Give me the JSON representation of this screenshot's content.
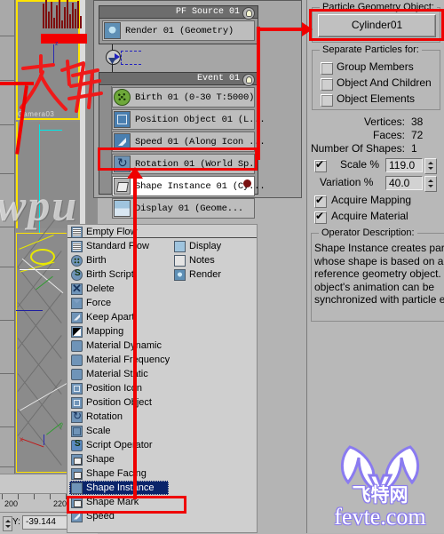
{
  "viewport": {
    "camera_label": "Camera03",
    "ruler_ticks": [
      "200",
      "220"
    ],
    "coord_axis_label": "Y:",
    "coord_value": "-39.144",
    "axis_z_label": "z",
    "axis_x_label": "x",
    "axis_y_label": "y"
  },
  "watermark": {
    "text": "wpu"
  },
  "particle_view": {
    "source": {
      "title": "PF Source 01",
      "rows": [
        {
          "label": "Render 01  (Geometry)",
          "icon": "render-icon"
        }
      ]
    },
    "event": {
      "title": "Event 01",
      "rows": [
        {
          "label": "Birth 01  (0-30 T:5000)",
          "icon": "birth-icon"
        },
        {
          "label": "Position Object 01  (L...",
          "icon": "position-object-icon"
        },
        {
          "label": "Speed 01 (Along Icon ...",
          "icon": "speed-icon"
        },
        {
          "label": "Rotation 01  (World Sp..",
          "icon": "rotation-icon"
        },
        {
          "label": "Shape Instance 01  (Cy...",
          "icon": "shape-instance-icon"
        },
        {
          "label": "Display 01  (Geome...",
          "icon": "display-icon"
        }
      ],
      "selected_row_index": 4
    }
  },
  "depot": {
    "column1": [
      {
        "label": "Empty Flow",
        "icon": "flow-icon"
      },
      {
        "label": "Standard Flow",
        "icon": "flow-icon"
      },
      {
        "label": "Birth",
        "icon": "birth-icon"
      },
      {
        "label": "Birth Script",
        "icon": "birth-script-icon"
      },
      {
        "label": "Delete",
        "icon": "delete-icon"
      },
      {
        "label": "Force",
        "icon": "force-icon"
      },
      {
        "label": "Keep Apart",
        "icon": "keep-apart-icon"
      },
      {
        "label": "Mapping",
        "icon": "mapping-icon"
      },
      {
        "label": "Material Dynamic",
        "icon": "material-icon"
      },
      {
        "label": "Material Frequency",
        "icon": "material-icon"
      },
      {
        "label": "Material Static",
        "icon": "material-icon"
      },
      {
        "label": "Position Icon",
        "icon": "position-icon"
      },
      {
        "label": "Position Object",
        "icon": "position-object-icon"
      },
      {
        "label": "Rotation",
        "icon": "rotation-icon"
      },
      {
        "label": "Scale",
        "icon": "scale-icon"
      },
      {
        "label": "Script Operator",
        "icon": "script-operator-icon"
      },
      {
        "label": "Shape",
        "icon": "shape-icon"
      },
      {
        "label": "Shape Facing",
        "icon": "shape-facing-icon"
      },
      {
        "label": "Shape Instance",
        "icon": "shape-instance-icon"
      },
      {
        "label": "Shape Mark",
        "icon": "shape-mark-icon"
      },
      {
        "label": "Speed",
        "icon": "speed-icon"
      }
    ],
    "column2": [
      {
        "label": "Display",
        "icon": "display-icon"
      },
      {
        "label": "Notes",
        "icon": "notes-icon"
      },
      {
        "label": "Render",
        "icon": "render-icon"
      }
    ],
    "selected_label": "Shape Instance"
  },
  "command_panel": {
    "geometry_group": {
      "title": "Particle Geometry Object:",
      "pick_button_label": "Cylinder01"
    },
    "separate_group": {
      "title": "Separate Particles for:",
      "checkboxes": [
        {
          "label": "Group Members",
          "checked": false
        },
        {
          "label": "Object And Children",
          "checked": false
        },
        {
          "label": "Object Elements",
          "checked": false
        }
      ]
    },
    "stats": [
      {
        "label": "Vertices:",
        "value": "38"
      },
      {
        "label": "Faces:",
        "value": "72"
      },
      {
        "label": "Number Of Shapes:",
        "value": "1"
      }
    ],
    "scale": {
      "checkbox_label": "Scale %",
      "checked": true,
      "value": "119.0",
      "variation_label": "Variation %",
      "variation_value": "40.0"
    },
    "acquire": [
      {
        "label": "Acquire Mapping",
        "checked": true
      },
      {
        "label": "Acquire Material",
        "checked": true
      }
    ],
    "description": {
      "title": "Operator Description:",
      "lines": [
        "Shape Instance creates particles",
        "whose shape is based on a",
        "reference geometry object. The",
        "object's animation can be",
        "synchronized with particle events"
      ]
    }
  },
  "logo": {
    "wordmark": "fevte.com",
    "chinese": "飞特网"
  },
  "colors": {
    "annotation_red": "#ef0000",
    "selection_blue": "#0a246a",
    "panel_gray": "#b8b8b8",
    "highlight_yellow": "#ffe400"
  }
}
